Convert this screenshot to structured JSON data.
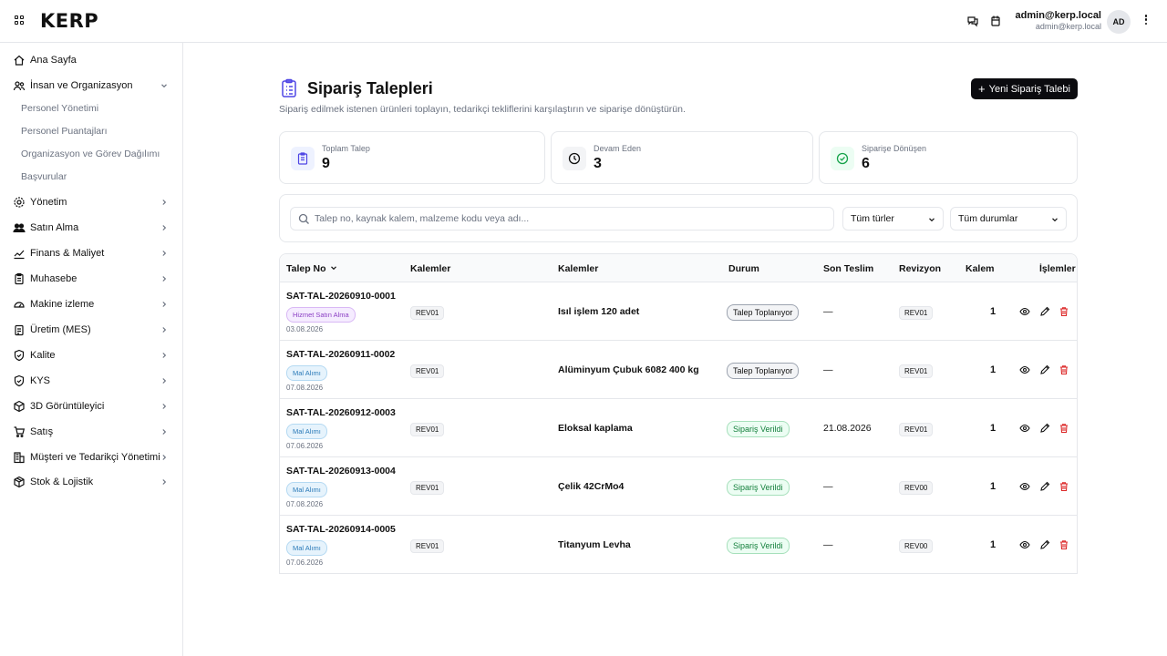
{
  "app": {
    "logo": "KERP"
  },
  "user": {
    "name": "admin@kerp.local",
    "email": "admin@kerp.local",
    "initials": "AD"
  },
  "sidebar": {
    "items": [
      {
        "label": "Ana Sayfa",
        "icon": "home-icon"
      },
      {
        "label": "İnsan ve Organizasyon",
        "icon": "users-icon",
        "expanded": true
      },
      {
        "label": "Yönetim",
        "icon": "gear-icon"
      },
      {
        "label": "Satın Alma",
        "icon": "user-group-icon"
      },
      {
        "label": "Finans & Maliyet",
        "icon": "chart-line-icon"
      },
      {
        "label": "Muhasebe",
        "icon": "clipboard-icon"
      },
      {
        "label": "Makine izleme",
        "icon": "gauge-icon"
      },
      {
        "label": "Üretim (MES)",
        "icon": "clipboard-list-icon"
      },
      {
        "label": "Kalite",
        "icon": "shield-check-icon"
      },
      {
        "label": "KYS",
        "icon": "shield-icon"
      },
      {
        "label": "3D Görüntüleyici",
        "icon": "cube-icon"
      },
      {
        "label": "Satış",
        "icon": "cart-icon"
      },
      {
        "label": "Müşteri ve Tedarikçi Yönetimi",
        "icon": "building-icon"
      },
      {
        "label": "Stok & Lojistik",
        "icon": "package-icon"
      }
    ],
    "subitems": [
      "Personel Yönetimi",
      "Personel Puantajları",
      "Organizasyon ve Görev Dağılımı",
      "Başvurular"
    ]
  },
  "page": {
    "title": "Sipariş Talepleri",
    "subtitle": "Sipariş edilmek istenen ürünleri toplayın, tedarikçi tekliflerini karşılaştırın ve siparişe dönüştürün.",
    "new_button": "Yeni Sipariş Talebi"
  },
  "stats": [
    {
      "label": "Toplam Talep",
      "value": "9",
      "color": "#6366f1"
    },
    {
      "label": "Devam Eden",
      "value": "3",
      "color": "#111827"
    },
    {
      "label": "Siparişe Dönüşen",
      "value": "6",
      "color": "#16a34a"
    }
  ],
  "filters": {
    "search_placeholder": "Talep no, kaynak kalem, malzeme kodu veya adı...",
    "type_select": "Tüm türler",
    "status_select": "Tüm durumlar"
  },
  "table": {
    "headers": [
      "Talep No",
      "Kalemler",
      "Kalemler",
      "Durum",
      "Son Teslim",
      "Revizyon",
      "Kalem",
      "İşlemler"
    ],
    "rows": [
      {
        "no": "SAT-TAL-20260910-0001",
        "tag": "Hizmet Satın Alma",
        "tag_type": "hizmet",
        "date": "03.08.2026",
        "rev_a": "REV01",
        "item": "Isıl işlem 120 adet",
        "status": "Talep Toplanıyor",
        "status_type": "toplan",
        "due": "—",
        "rev_b": "REV01",
        "qty": "1"
      },
      {
        "no": "SAT-TAL-20260911-0002",
        "tag": "Mal Alımı",
        "tag_type": "mal",
        "date": "07.08.2026",
        "rev_a": "REV01",
        "item": "Alüminyum Çubuk 6082 400 kg",
        "status": "Talep Toplanıyor",
        "status_type": "toplan",
        "due": "—",
        "rev_b": "REV01",
        "qty": "1"
      },
      {
        "no": "SAT-TAL-20260912-0003",
        "tag": "Mal Alımı",
        "tag_type": "mal",
        "date": "07.06.2026",
        "rev_a": "REV01",
        "item": "Eloksal kaplama",
        "status": "Sipariş Verildi",
        "status_type": "verildi",
        "due": "21.08.2026",
        "rev_b": "REV01",
        "qty": "1"
      },
      {
        "no": "SAT-TAL-20260913-0004",
        "tag": "Mal Alımı",
        "tag_type": "mal",
        "date": "07.08.2026",
        "rev_a": "REV01",
        "item": "Çelik 42CrMo4",
        "status": "Sipariş Verildi",
        "status_type": "verildi",
        "due": "—",
        "rev_b": "REV00",
        "qty": "1"
      },
      {
        "no": "SAT-TAL-20260914-0005",
        "tag": "Mal Alımı",
        "tag_type": "mal",
        "date": "07.06.2026",
        "rev_a": "REV01",
        "item": "Titanyum Levha",
        "status": "Sipariş Verildi",
        "status_type": "verildi",
        "due": "—",
        "rev_b": "REV00",
        "qty": "1"
      }
    ]
  }
}
